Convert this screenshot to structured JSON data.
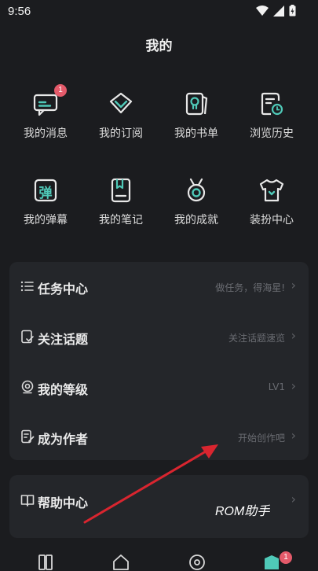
{
  "status_bar": {
    "time": "9:56"
  },
  "page_title": "我的",
  "grid": [
    {
      "label": "我的消息",
      "icon": "message-icon",
      "badge": "1"
    },
    {
      "label": "我的订阅",
      "icon": "diamond-subscribe-icon"
    },
    {
      "label": "我的书单",
      "icon": "booklist-icon"
    },
    {
      "label": "浏览历史",
      "icon": "history-icon"
    },
    {
      "label": "我的弹幕",
      "icon": "danmaku-icon",
      "glyph": "弹"
    },
    {
      "label": "我的笔记",
      "icon": "note-icon"
    },
    {
      "label": "我的成就",
      "icon": "medal-icon"
    },
    {
      "label": "装扮中心",
      "icon": "shirt-icon"
    }
  ],
  "menu": [
    {
      "label": "任务中心",
      "hint": "做任务，得海星!",
      "icon": "list-icon"
    },
    {
      "label": "关注话题",
      "hint": "关注话题速览",
      "icon": "topic-icon"
    },
    {
      "label": "我的等级",
      "hint": "LV1",
      "icon": "level-icon"
    },
    {
      "label": "成为作者",
      "hint": "开始创作吧",
      "icon": "author-icon"
    }
  ],
  "help": {
    "label": "帮助中心",
    "icon": "help-book-icon"
  },
  "chevron": "›",
  "overlay": {
    "watermark": "ROM助手"
  },
  "bottom_nav": {
    "badge": "1"
  },
  "colors": {
    "accent": "#4fc9b8",
    "background": "#1b1c1f",
    "panel": "#24262a",
    "badge": "#e45a6a",
    "arrow": "#d9252f"
  }
}
